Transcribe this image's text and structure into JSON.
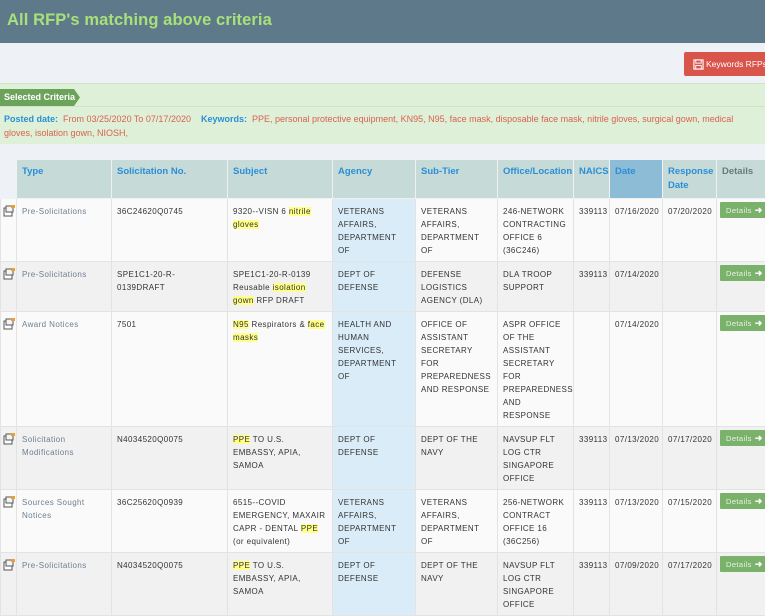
{
  "page": {
    "title": "All RFP's matching above criteria"
  },
  "toolbar": {
    "keywords_button_label": "Keywords RFPs",
    "keywords_button_icon": "save-icon"
  },
  "criteria": {
    "tag_label": "Selected Criteria",
    "posted_date_label": "Posted date:",
    "posted_date_value": "From 03/25/2020 To 07/17/2020",
    "keywords_label": "Keywords:",
    "keywords_value": "PPE, personal protective equipment, KN95, N95, face mask, disposable face mask, nitrile gloves, surgical gown, medical gloves, isolation gown, NIOSH,"
  },
  "table": {
    "columns": [
      "Type",
      "Solicitation No.",
      "Subject",
      "Agency",
      "Sub-Tier",
      "Office/Location",
      "NAICS",
      "Date",
      "Response Date",
      "Details"
    ],
    "sorted_column": "Date",
    "details_label": "Details",
    "row_icon": "notice-document-icon",
    "highlight_color": "#ffff8a",
    "rows": [
      {
        "type": "Pre-Solicitations",
        "solicitation_no": "36C24620Q0745",
        "subject": [
          {
            "t": "9320--VISN 6 "
          },
          {
            "t": "nitrile gloves",
            "hl": true
          }
        ],
        "agency": "VETERANS AFFAIRS, DEPARTMENT OF",
        "sub_tier": "VETERANS AFFAIRS, DEPARTMENT OF",
        "office": "246-NETWORK CONTRACTING OFFICE 6 (36C246)",
        "naics": "339113",
        "date": "07/16/2020",
        "response_date": "07/20/2020"
      },
      {
        "type": "Pre-Solicitations",
        "solicitation_no": "SPE1C1-20-R-0139DRAFT",
        "subject": [
          {
            "t": "SPE1C1-20-R-0139 Reusable "
          },
          {
            "t": "isolation gown",
            "hl": true
          },
          {
            "t": " RFP DRAFT"
          }
        ],
        "agency": "DEPT OF DEFENSE",
        "sub_tier": "DEFENSE LOGISTICS AGENCY (DLA)",
        "office": "DLA TROOP SUPPORT",
        "naics": "339113",
        "date": "07/14/2020",
        "response_date": ""
      },
      {
        "type": "Award Notices",
        "solicitation_no": "7501",
        "subject": [
          {
            "t": "N95",
            "hl": true
          },
          {
            "t": " Respirators & "
          },
          {
            "t": "face masks",
            "hl": true
          }
        ],
        "agency": "HEALTH AND HUMAN SERVICES, DEPARTMENT OF",
        "sub_tier": "OFFICE OF ASSISTANT SECRETARY FOR PREPAREDNESS AND RESPONSE",
        "office": "ASPR OFFICE OF THE ASSISTANT SECRETARY FOR PREPAREDNESS AND RESPONSE",
        "naics": "",
        "date": "07/14/2020",
        "response_date": ""
      },
      {
        "type": "Solicitation Modifications",
        "solicitation_no": "N4034520Q0075",
        "subject": [
          {
            "t": "PPE",
            "hl": true
          },
          {
            "t": " TO U.S. EMBASSY, APIA, SAMOA"
          }
        ],
        "agency": "DEPT OF DEFENSE",
        "sub_tier": "DEPT OF THE NAVY",
        "office": "NAVSUP FLT LOG CTR SINGAPORE OFFICE",
        "naics": "339113",
        "date": "07/13/2020",
        "response_date": "07/17/2020"
      },
      {
        "type": "Sources Sought Notices",
        "solicitation_no": "36C25620Q0939",
        "subject": [
          {
            "t": "6515--COVID EMERGENCY, MAXAIR CAPR - DENTAL "
          },
          {
            "t": "PPE",
            "hl": true
          },
          {
            "t": " (or equivalent)"
          }
        ],
        "agency": "VETERANS AFFAIRS, DEPARTMENT OF",
        "sub_tier": "VETERANS AFFAIRS, DEPARTMENT OF",
        "office": "256-NETWORK CONTRACT OFFICE 16 (36C256)",
        "naics": "339113",
        "date": "07/13/2020",
        "response_date": "07/15/2020"
      },
      {
        "type": "Pre-Solicitations",
        "solicitation_no": "N4034520Q0075",
        "subject": [
          {
            "t": "PPE",
            "hl": true
          },
          {
            "t": " TO U.S. EMBASSY, APIA, SAMOA"
          }
        ],
        "agency": "DEPT OF DEFENSE",
        "sub_tier": "DEPT OF THE NAVY",
        "office": "NAVSUP FLT LOG CTR SINGAPORE OFFICE",
        "naics": "339113",
        "date": "07/09/2020",
        "response_date": "07/17/2020"
      }
    ]
  }
}
